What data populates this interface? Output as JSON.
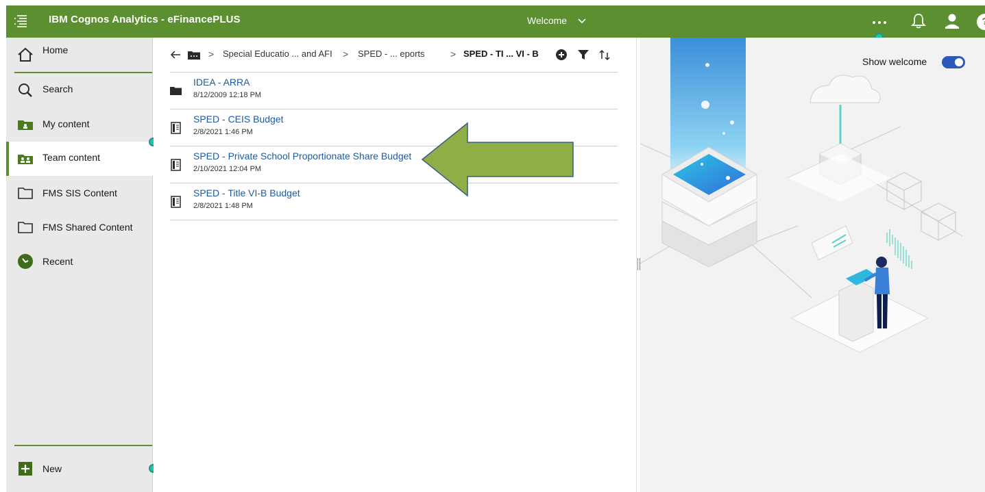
{
  "topbar": {
    "app_title": "IBM Cognos Analytics - eFinancePLUS",
    "welcome_label": "Welcome",
    "more_label": "···",
    "help_label": "?"
  },
  "sidebar": {
    "items": [
      {
        "label": "Home",
        "icon": "home-icon"
      },
      {
        "label": "Search",
        "icon": "search-icon"
      },
      {
        "label": "My content",
        "icon": "my-content-folder-icon"
      },
      {
        "label": "Team content",
        "icon": "team-content-folder-icon",
        "active": true
      },
      {
        "label": "FMS SIS Content",
        "icon": "folder-icon"
      },
      {
        "label": "FMS Shared Content",
        "icon": "folder-icon"
      },
      {
        "label": "Recent",
        "icon": "recent-icon"
      }
    ],
    "new_label": "New"
  },
  "breadcrumb": {
    "items": [
      "Special Educatio ... and AFI",
      "SPED - ... eports",
      "SPED - TI ... VI - B"
    ]
  },
  "list": {
    "rows": [
      {
        "name": "IDEA - ARRA",
        "date": "8/12/2009 12:18 PM",
        "icon": "folder-icon"
      },
      {
        "name": "SPED - CEIS Budget",
        "date": "2/8/2021 1:46 PM",
        "icon": "report-icon"
      },
      {
        "name": "SPED - Private School Proportionate Share Budget",
        "date": "2/10/2021 12:04 PM",
        "icon": "report-icon"
      },
      {
        "name": "SPED - Title VI-B Budget",
        "date": "2/8/2021 1:48 PM",
        "icon": "report-icon"
      }
    ]
  },
  "welcome_panel": {
    "show_welcome_label": "Show welcome",
    "show_welcome_on": true
  },
  "colors": {
    "brand_green": "#5b8f30",
    "link_blue": "#1c5a9e",
    "toggle_blue": "#2c58b9",
    "teal_dot": "#24c7a5",
    "annotation_arrow": "#8fae45"
  }
}
